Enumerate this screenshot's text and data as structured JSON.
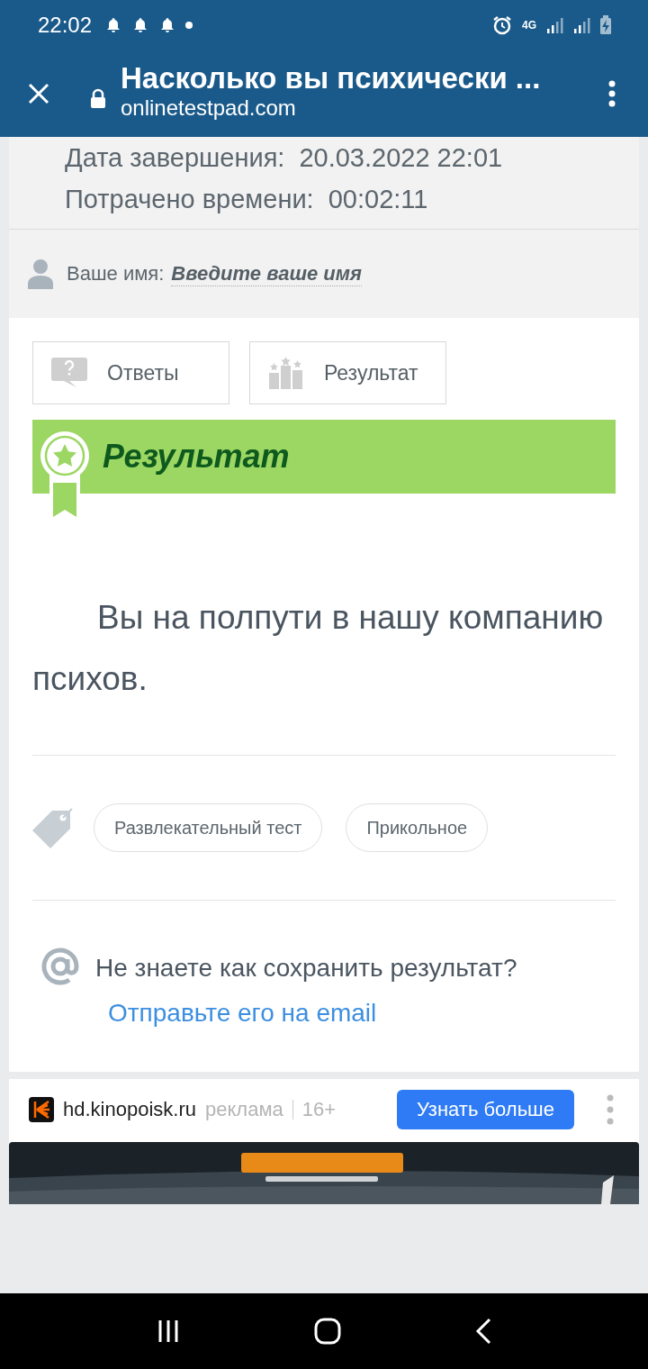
{
  "status_bar": {
    "time": "22:02",
    "network": "4G"
  },
  "browser": {
    "title": "Насколько вы психически ...",
    "url": "onlinetestpad.com"
  },
  "summary": {
    "rows": [
      {
        "label": "Дата завершения:",
        "value": "20.03.2022 22:01"
      },
      {
        "label": "Потрачено времени:",
        "value": "00:02:11"
      }
    ],
    "name_label": "Ваше имя:",
    "name_value": "Введите ваше имя"
  },
  "buttons": [
    {
      "kind": "answers",
      "label": "Ответы"
    },
    {
      "kind": "result",
      "label": "Результат"
    }
  ],
  "result": {
    "heading": "Результат",
    "text": "Вы на полпути в нашу компанию психов."
  },
  "tags": [
    "Развлекательный тест",
    "Прикольное"
  ],
  "save": {
    "text": "Не знаете как сохранить результат?",
    "link": "Отправьте его на email"
  },
  "ad": {
    "domain": "hd.kinopoisk.ru",
    "label": "реклама",
    "age": "16+",
    "button": "Узнать больше"
  }
}
